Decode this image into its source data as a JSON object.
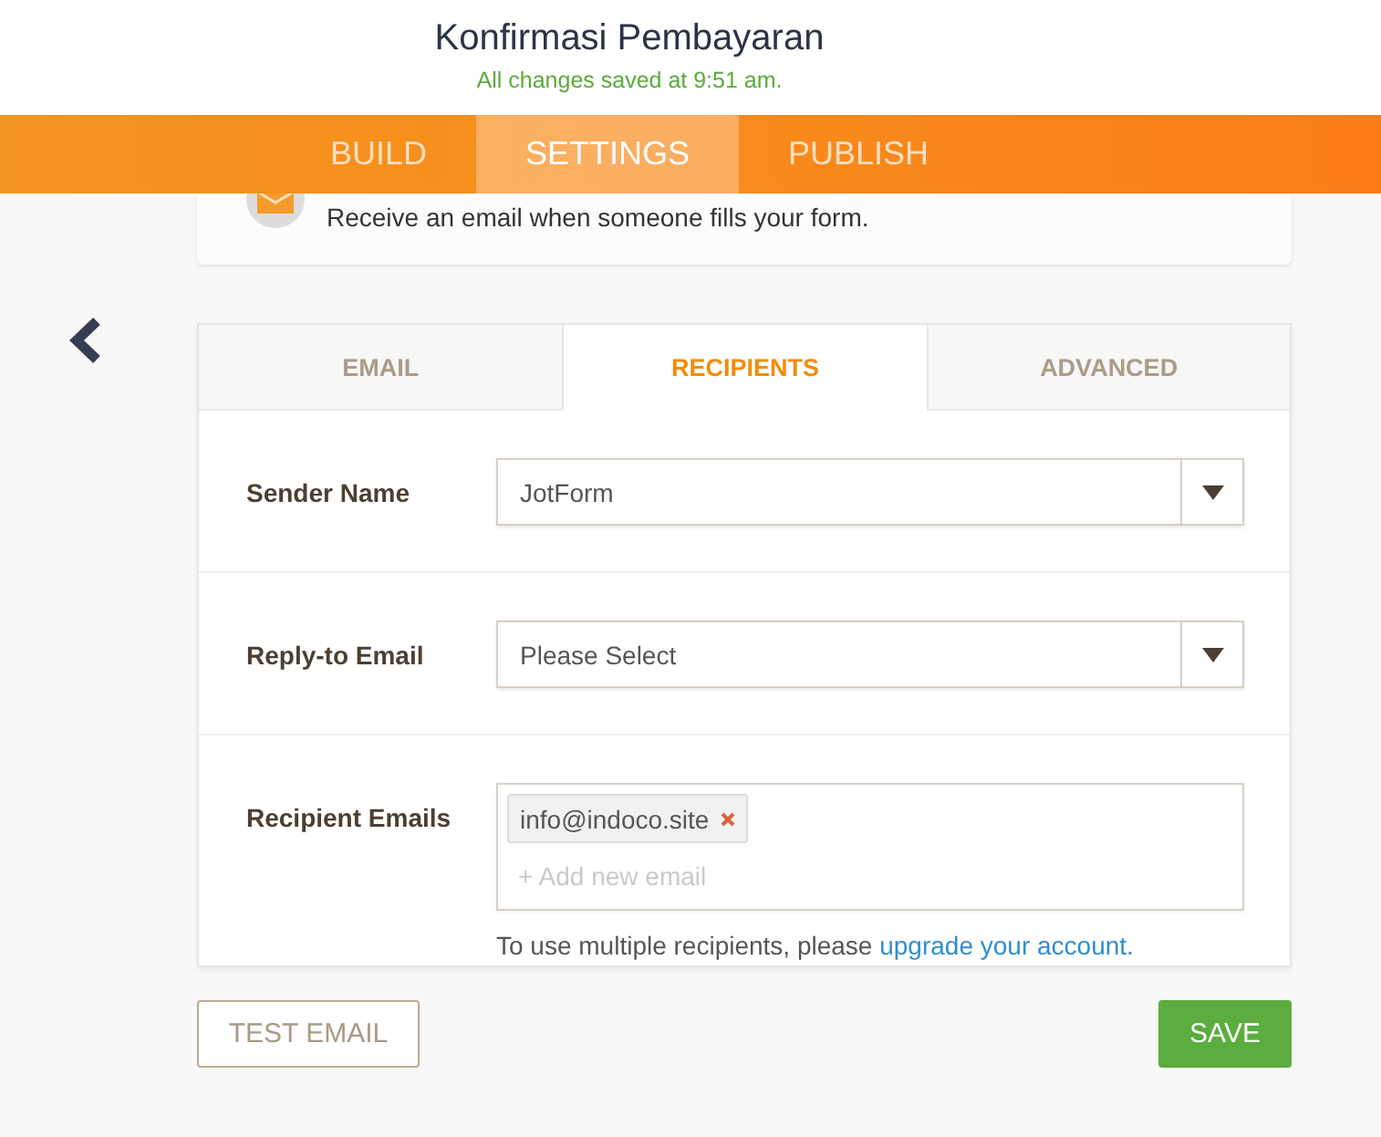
{
  "header": {
    "title": "Konfirmasi Pembayaran",
    "status": "All changes saved at 9:51 am."
  },
  "nav_tabs": [
    {
      "label": "BUILD",
      "selected": false
    },
    {
      "label": "SETTINGS",
      "selected": true
    },
    {
      "label": "PUBLISH",
      "selected": false
    }
  ],
  "notification_card": {
    "description": "Receive an email when someone fills your form."
  },
  "email_settings": {
    "tabs": [
      {
        "label": "EMAIL",
        "selected": false
      },
      {
        "label": "RECIPIENTS",
        "selected": true
      },
      {
        "label": "ADVANCED",
        "selected": false
      }
    ],
    "fields": [
      {
        "kind": "select",
        "label": "Sender Name",
        "value": "JotForm"
      },
      {
        "kind": "select",
        "label": "Reply-to Email",
        "value": "Please Select"
      },
      {
        "kind": "tags",
        "label": "Recipient Emails",
        "tags": [
          "info@indoco.site"
        ],
        "placeholder": "+ Add new email",
        "hint": {
          "text": "To use multiple recipients, please ",
          "link": "upgrade your account."
        }
      }
    ]
  },
  "buttons": [
    {
      "kind": "outline",
      "label": "TEST EMAIL"
    },
    {
      "kind": "primary",
      "label": "SAVE"
    }
  ]
}
